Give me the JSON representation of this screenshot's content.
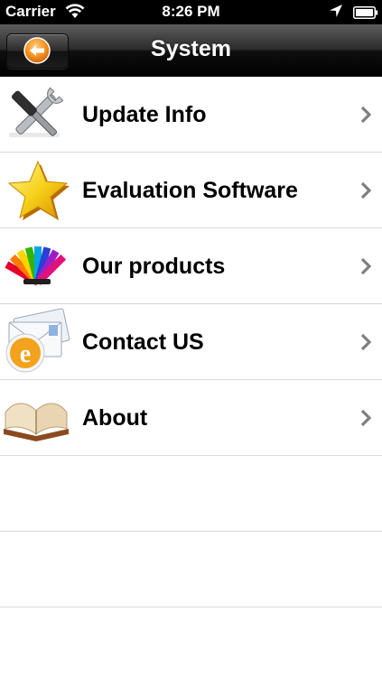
{
  "status_bar": {
    "carrier": "Carrier",
    "time": "8:26 PM"
  },
  "nav": {
    "title": "System"
  },
  "menu": {
    "items": [
      {
        "label": "Update Info",
        "icon": "tools-icon"
      },
      {
        "label": "Evaluation Software",
        "icon": "star-icon"
      },
      {
        "label": "Our products",
        "icon": "color-swatches-icon"
      },
      {
        "label": "Contact US",
        "icon": "email-icon"
      },
      {
        "label": "About",
        "icon": "open-book-icon"
      }
    ]
  },
  "colors": {
    "nav_bar": "#1a1a1a",
    "back_arrow": "#f08a1c",
    "separator": "#d9d9d9",
    "chevron": "#7f7f7f"
  }
}
